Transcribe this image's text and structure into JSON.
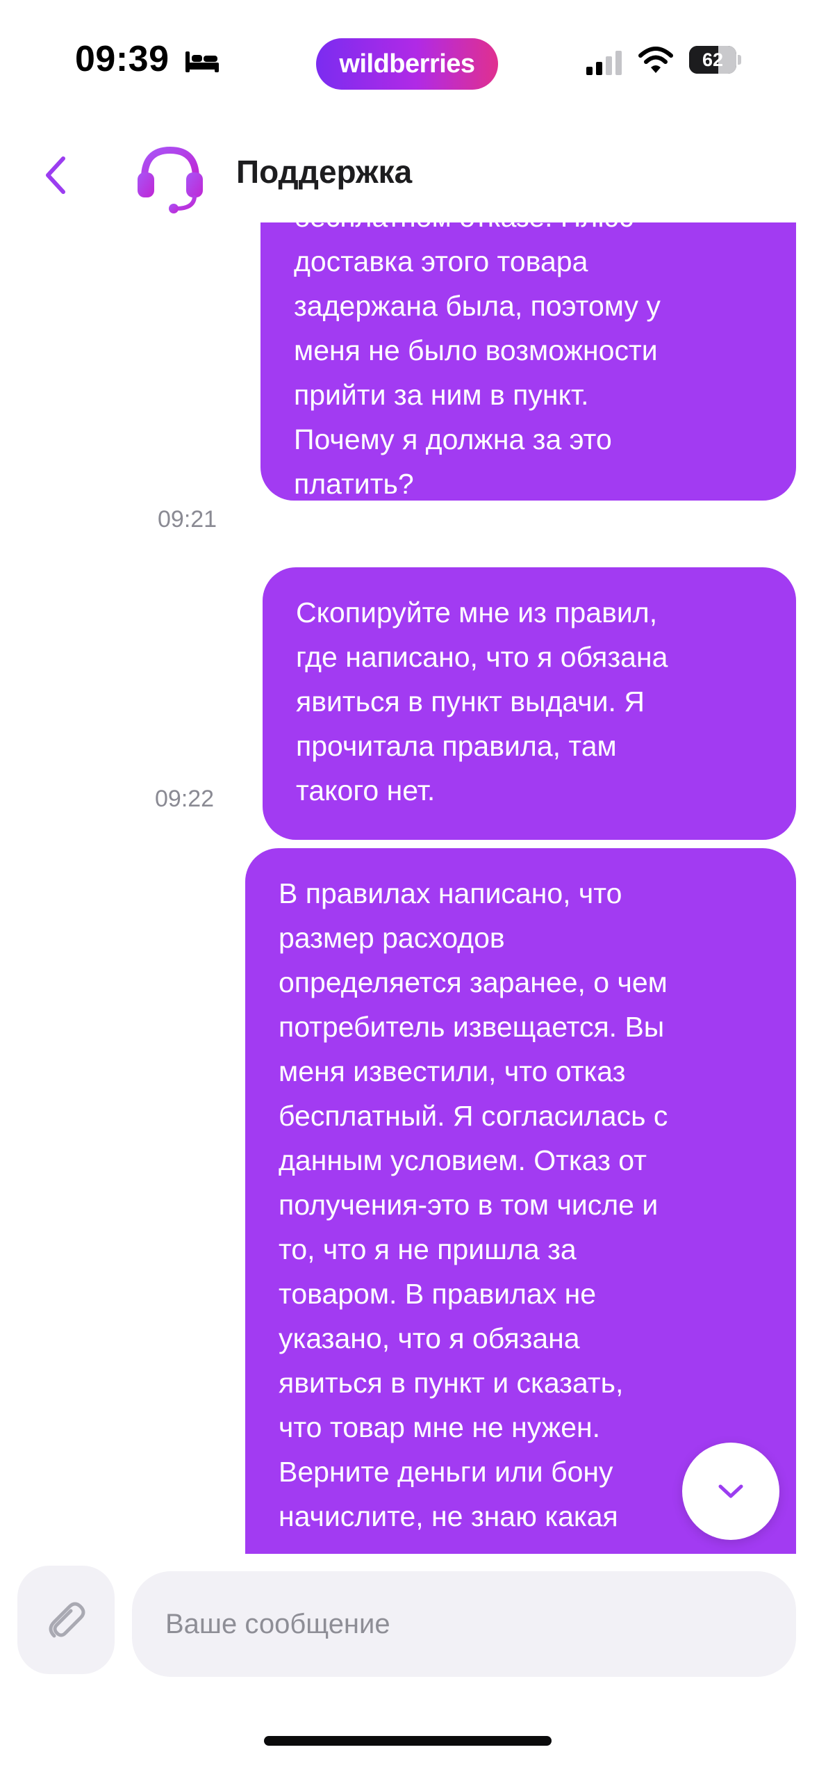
{
  "status_bar": {
    "time": "09:39",
    "brand": "wildberries",
    "battery_level": "62",
    "battery_fraction": 0.62,
    "icons": [
      "bed-icon",
      "signal-icon",
      "wifi-icon",
      "battery-icon"
    ]
  },
  "header": {
    "title": "Поддержка",
    "back_icon": "chevron-left-icon",
    "avatar_icon": "headset-icon"
  },
  "messages": [
    {
      "time": "09:21",
      "text": "бесплатном отказе. Плюс\nдоставка этого товара\nзадержана была, поэтому у\nменя не было возможности\nприйти за ним в пункт.\nПочему я должна за это\nплатить?"
    },
    {
      "time": "09:22",
      "text": "Скопируйте мне из правил,\nгде написано, что я обязана\nявиться в пункт выдачи. Я\nпрочитала правила, там\nтакого нет."
    },
    {
      "time": "",
      "text": "В правилах написано, что\nразмер расходов\nопределяется заранее, о чем\nпотребитель извещается. Вы\nменя известили, что отказ\nбесплатный. Я согласилась с\nданным условием. Отказ от\nполучения-это в том числе и\nто, что я не пришла за\nтоваром. В правилах не\nуказано, что я обязана\nявиться в пункт и сказать,\nчто товар мне не нужен.\nВерните деньги или бону\nначислите, не знаю какая"
    }
  ],
  "composer": {
    "placeholder": "Ваше сообщение",
    "value": "",
    "attach_icon": "paperclip-icon"
  },
  "scroll_down_icon": "chevron-down-icon",
  "colors": {
    "bubble": "#a23bf2",
    "accent": "#a23bf2",
    "brand_gradient_start": "#7b2cf0",
    "brand_gradient_end": "#e0308f",
    "timestamp": "#8a8a93",
    "input_bg": "#f2f1f6"
  }
}
